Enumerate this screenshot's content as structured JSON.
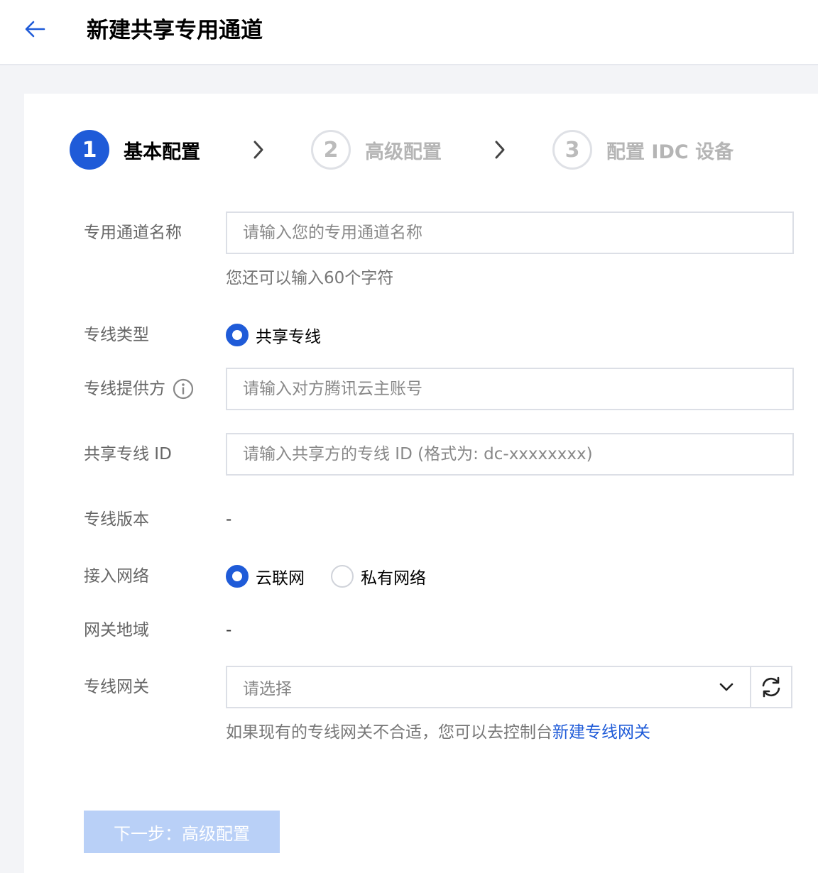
{
  "header": {
    "title": "新建共享专用通道",
    "back_icon": "arrow-left-icon"
  },
  "steps": [
    {
      "number": "1",
      "label": "基本配置",
      "state": "active"
    },
    {
      "number": "2",
      "label": "高级配置",
      "state": "inactive"
    },
    {
      "number": "3",
      "label": "配置 IDC 设备",
      "state": "inactive"
    }
  ],
  "form": {
    "channel_name": {
      "label": "专用通道名称",
      "placeholder": "请输入您的专用通道名称",
      "value": "",
      "hint": "您还可以输入60个字符"
    },
    "line_type": {
      "label": "专线类型",
      "option": "共享专线"
    },
    "provider": {
      "label": "专线提供方",
      "placeholder": "请输入对方腾讯云主账号",
      "value": ""
    },
    "shared_id": {
      "label": "共享专线 ID",
      "placeholder": "请输入共享方的专线 ID (格式为: dc-xxxxxxxx)",
      "value": ""
    },
    "version": {
      "label": "专线版本",
      "value": "-"
    },
    "network": {
      "label": "接入网络",
      "options": [
        "云联网",
        "私有网络"
      ],
      "selected": "云联网"
    },
    "region": {
      "label": "网关地域",
      "value": "-"
    },
    "gateway": {
      "label": "专线网关",
      "placeholder": "请选择",
      "hint_prefix": "如果现有的专线网关不合适，您可以去控制台",
      "hint_link": "新建专线网关"
    }
  },
  "footer": {
    "next_label": "下一步：高级配置"
  },
  "colors": {
    "primary": "#1f5bd8",
    "disabled_button": "#b9d0f7"
  }
}
